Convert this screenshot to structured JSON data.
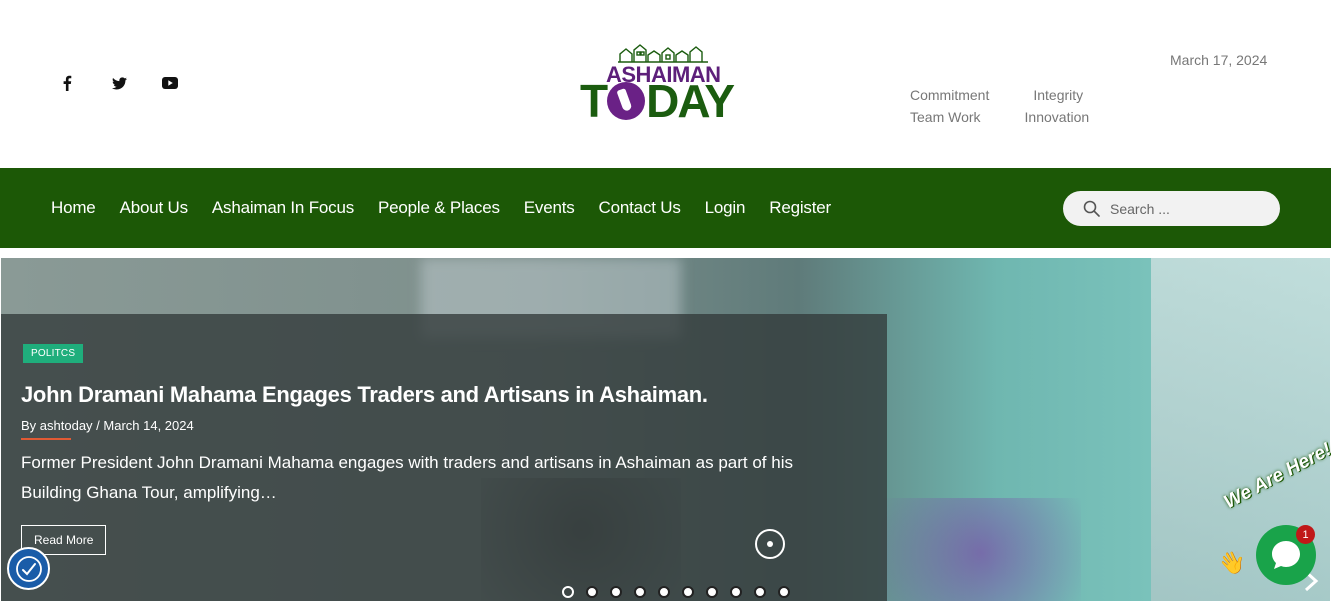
{
  "header": {
    "date": "March 17, 2024",
    "values": [
      "Commitment",
      "Integrity",
      "Team Work",
      "Innovation"
    ],
    "logo": {
      "top": "ASHAIMAN",
      "bottom_a": "T",
      "bottom_b": "DAY"
    },
    "social": [
      "facebook-icon",
      "twitter-icon",
      "youtube-icon"
    ]
  },
  "nav": {
    "items": [
      "Home",
      "About Us",
      "Ashaiman In Focus",
      "People & Places",
      "Events",
      "Contact Us",
      "Login",
      "Register"
    ],
    "search_placeholder": "Search ..."
  },
  "hero": {
    "category": "POLITCS",
    "title": "John Dramani Mahama Engages Traders and Artisans in Ashaiman.",
    "byline": "By ashtoday / March 14, 2024",
    "excerpt": "Former President John Dramani Mahama engages with traders and artisans in Ashaiman as part of his Building Ghana Tour, amplifying…",
    "read_more": "Read More",
    "slide_count": 10,
    "active_slide": 1
  },
  "chat": {
    "label": "We Are Here!",
    "badge": "1"
  },
  "colors": {
    "nav": "#1c5806",
    "tag": "#1fae7c",
    "accent": "#e05a34",
    "logo_purple": "#5d1f7a",
    "logo_green": "#1b5c0f"
  }
}
